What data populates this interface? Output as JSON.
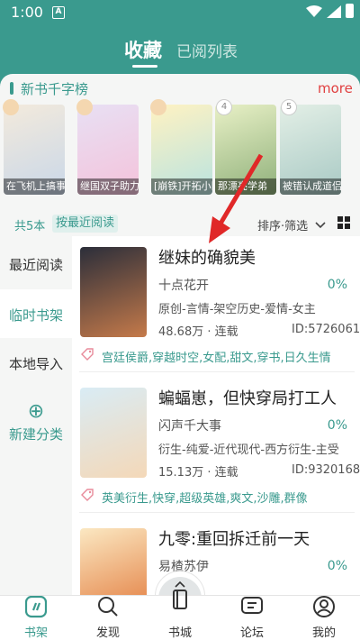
{
  "status_bar": {
    "time": "1:00",
    "notification_icon": "A"
  },
  "header": {
    "tab_collect": "收藏",
    "tab_read_list": "已阅列表"
  },
  "ranking": {
    "title": "新书千字榜",
    "more": "more",
    "books": [
      {
        "caption": "在飞机上搞事",
        "badge": "",
        "colors": [
          "#f3eadc",
          "#c9d7e8"
        ]
      },
      {
        "caption": "继国双子助力",
        "badge": "",
        "colors": [
          "#e8e0f4",
          "#f4c2da"
        ]
      },
      {
        "caption": "[崩铁]开拓小队",
        "badge": "",
        "colors": [
          "#fff2c2",
          "#b9e3e0"
        ]
      },
      {
        "caption": "那漂亮学弟",
        "badge": "4",
        "colors": [
          "#e8f0c6",
          "#8fb07a"
        ]
      },
      {
        "caption": "被错认成道侣",
        "badge": "5",
        "colors": [
          "#e3efe6",
          "#a8c9c4"
        ]
      }
    ]
  },
  "filter_bar": {
    "count": "共5本",
    "sort": "按最近阅读",
    "sort_filter": "排序·筛选"
  },
  "sidebar": {
    "items": [
      {
        "label": "最近阅读"
      },
      {
        "label": "临时书架"
      },
      {
        "label": "本地导入"
      }
    ],
    "new_category": "新建分类"
  },
  "books": [
    {
      "title": "继妹的确貌美",
      "author": "十点花开",
      "percent": "0%",
      "genre": "原创-言情-架空历史-爱情-女主",
      "stats": "48.68万 · 连载",
      "id": "ID:5726061",
      "tags": "宫廷侯爵,穿越时空,女配,甜文,穿书,日久生情",
      "cover_colors": [
        "#2b2e3a",
        "#c57a4a"
      ]
    },
    {
      "title": "蝙蝠崽，但快穿局打工人",
      "author": "闪声千大事",
      "percent": "0%",
      "genre": "衍生-纯爱-近代现代-西方衍生-主受",
      "stats": "15.13万 · 连载",
      "id": "ID:9320168",
      "tags": "英美衍生,快穿,超级英雄,爽文,沙雕,群像",
      "cover_colors": [
        "#d9ecf5",
        "#f4d8b8"
      ]
    },
    {
      "title": "九零:重回拆迁前一天",
      "author": "易楂苏伊",
      "percent": "0%",
      "genre": "",
      "stats": "",
      "id": "",
      "tags": "",
      "cover_colors": [
        "#fbe8c2",
        "#e27a3c"
      ]
    }
  ],
  "bottom_nav": {
    "shelf": "书架",
    "discover": "发现",
    "bookstore": "书城",
    "forum": "论坛",
    "mine": "我的"
  },
  "accent_color": "#3a9a8e"
}
